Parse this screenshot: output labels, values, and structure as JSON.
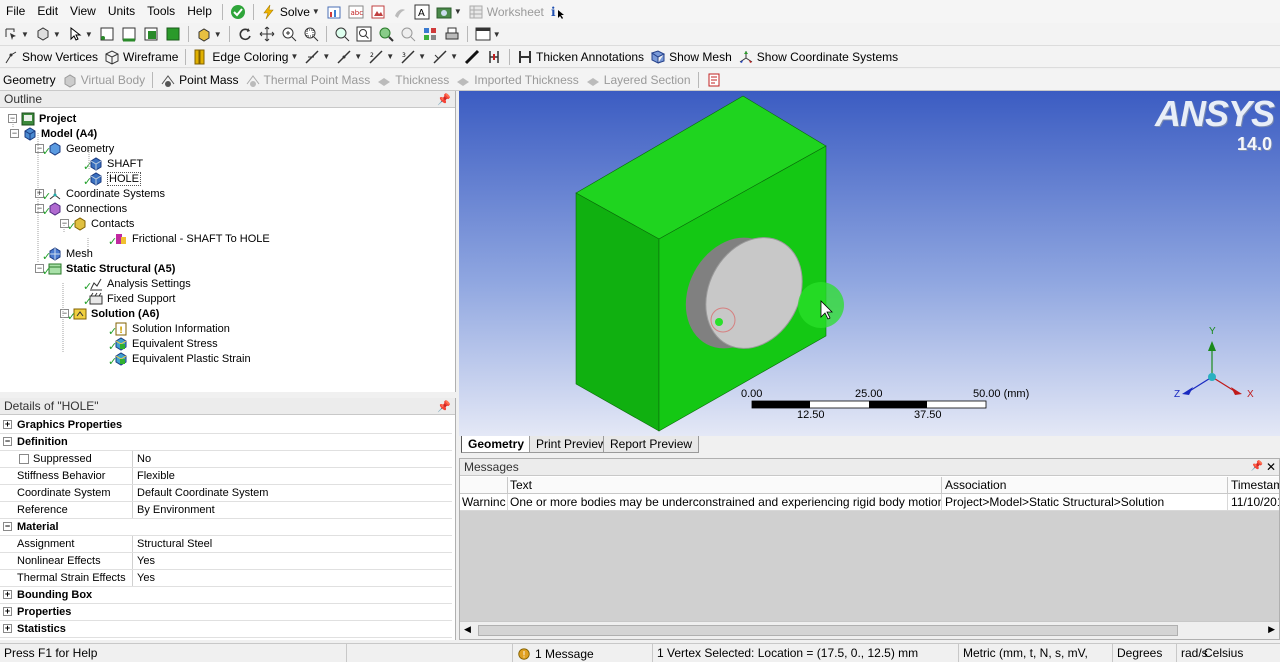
{
  "menubar": {
    "items": [
      "File",
      "Edit",
      "View",
      "Units",
      "Tools",
      "Help"
    ],
    "solve_label": "Solve",
    "worksheet_label": "Worksheet"
  },
  "toolbar2": {
    "show_vertices": "Show Vertices",
    "wireframe": "Wireframe",
    "edge_coloring": "Edge Coloring",
    "thicken_annotations": "Thicken Annotations",
    "show_mesh": "Show Mesh",
    "show_coordinate_systems": "Show Coordinate Systems"
  },
  "toolbar3": {
    "geometry": "Geometry",
    "virtual_body": "Virtual Body",
    "point_mass": "Point Mass",
    "thermal_point_mass": "Thermal Point Mass",
    "thickness": "Thickness",
    "imported_thickness": "Imported Thickness",
    "layered_section": "Layered Section"
  },
  "outline": {
    "title": "Outline",
    "nodes": [
      {
        "label": "Project",
        "bold": true
      },
      {
        "label": "Model (A4)",
        "bold": true
      },
      {
        "label": "Geometry"
      },
      {
        "label": "SHAFT"
      },
      {
        "label": "HOLE"
      },
      {
        "label": "Coordinate Systems"
      },
      {
        "label": "Connections"
      },
      {
        "label": "Contacts"
      },
      {
        "label": "Frictional - SHAFT To HOLE"
      },
      {
        "label": "Mesh"
      },
      {
        "label": "Static Structural (A5)",
        "bold": true
      },
      {
        "label": "Analysis Settings"
      },
      {
        "label": "Fixed Support"
      },
      {
        "label": "Solution (A6)",
        "bold": true
      },
      {
        "label": "Solution Information"
      },
      {
        "label": "Equivalent Stress"
      },
      {
        "label": "Equivalent Plastic Strain"
      }
    ]
  },
  "details": {
    "title": "Details of \"HOLE\"",
    "rows": [
      {
        "cat": true,
        "label": "Graphics Properties",
        "exp": "+"
      },
      {
        "cat": true,
        "label": "Definition",
        "exp": "−"
      },
      {
        "label": "Suppressed",
        "value": "No"
      },
      {
        "label": "Stiffness Behavior",
        "value": "Flexible"
      },
      {
        "label": "Coordinate System",
        "value": "Default Coordinate System"
      },
      {
        "label": "Reference Temperature",
        "value": "By Environment"
      },
      {
        "cat": true,
        "label": "Material",
        "exp": "−"
      },
      {
        "label": "Assignment",
        "value": "Structural Steel"
      },
      {
        "label": "Nonlinear Effects",
        "value": "Yes"
      },
      {
        "label": "Thermal Strain Effects",
        "value": "Yes"
      },
      {
        "cat": true,
        "label": "Bounding Box",
        "exp": "+"
      },
      {
        "cat": true,
        "label": "Properties",
        "exp": "+"
      },
      {
        "cat": true,
        "label": "Statistics",
        "exp": "+"
      }
    ]
  },
  "viewport": {
    "brand": "ANSYS",
    "version": "14.0",
    "scale": {
      "top": [
        "0.00",
        "25.00",
        "50.00 (mm)"
      ],
      "bottom": [
        "12.50",
        "37.50"
      ]
    },
    "axes": {
      "y": "Y",
      "x": "X",
      "z": "Z"
    },
    "body_color": "#12c412"
  },
  "tabs": [
    "Geometry",
    "Print Preview",
    "Report Preview"
  ],
  "messages": {
    "title": "Messages",
    "headers": [
      "",
      "Text",
      "Association",
      "Timestam"
    ],
    "row": [
      "Warninc",
      "One or more bodies may be underconstrained and experiencing rigid body motion. We",
      "Project>Model>Static Structural>Solution",
      "11/10/201"
    ]
  },
  "status": {
    "help": "Press F1 for Help",
    "messages": "1 Message",
    "selection": "1 Vertex Selected: Location = (17.5, 0., 12.5) mm",
    "units": "Metric (mm, t, N, s, mV, mA)",
    "angle": "Degrees",
    "rate": "rad/s",
    "temp": "Celsius"
  }
}
